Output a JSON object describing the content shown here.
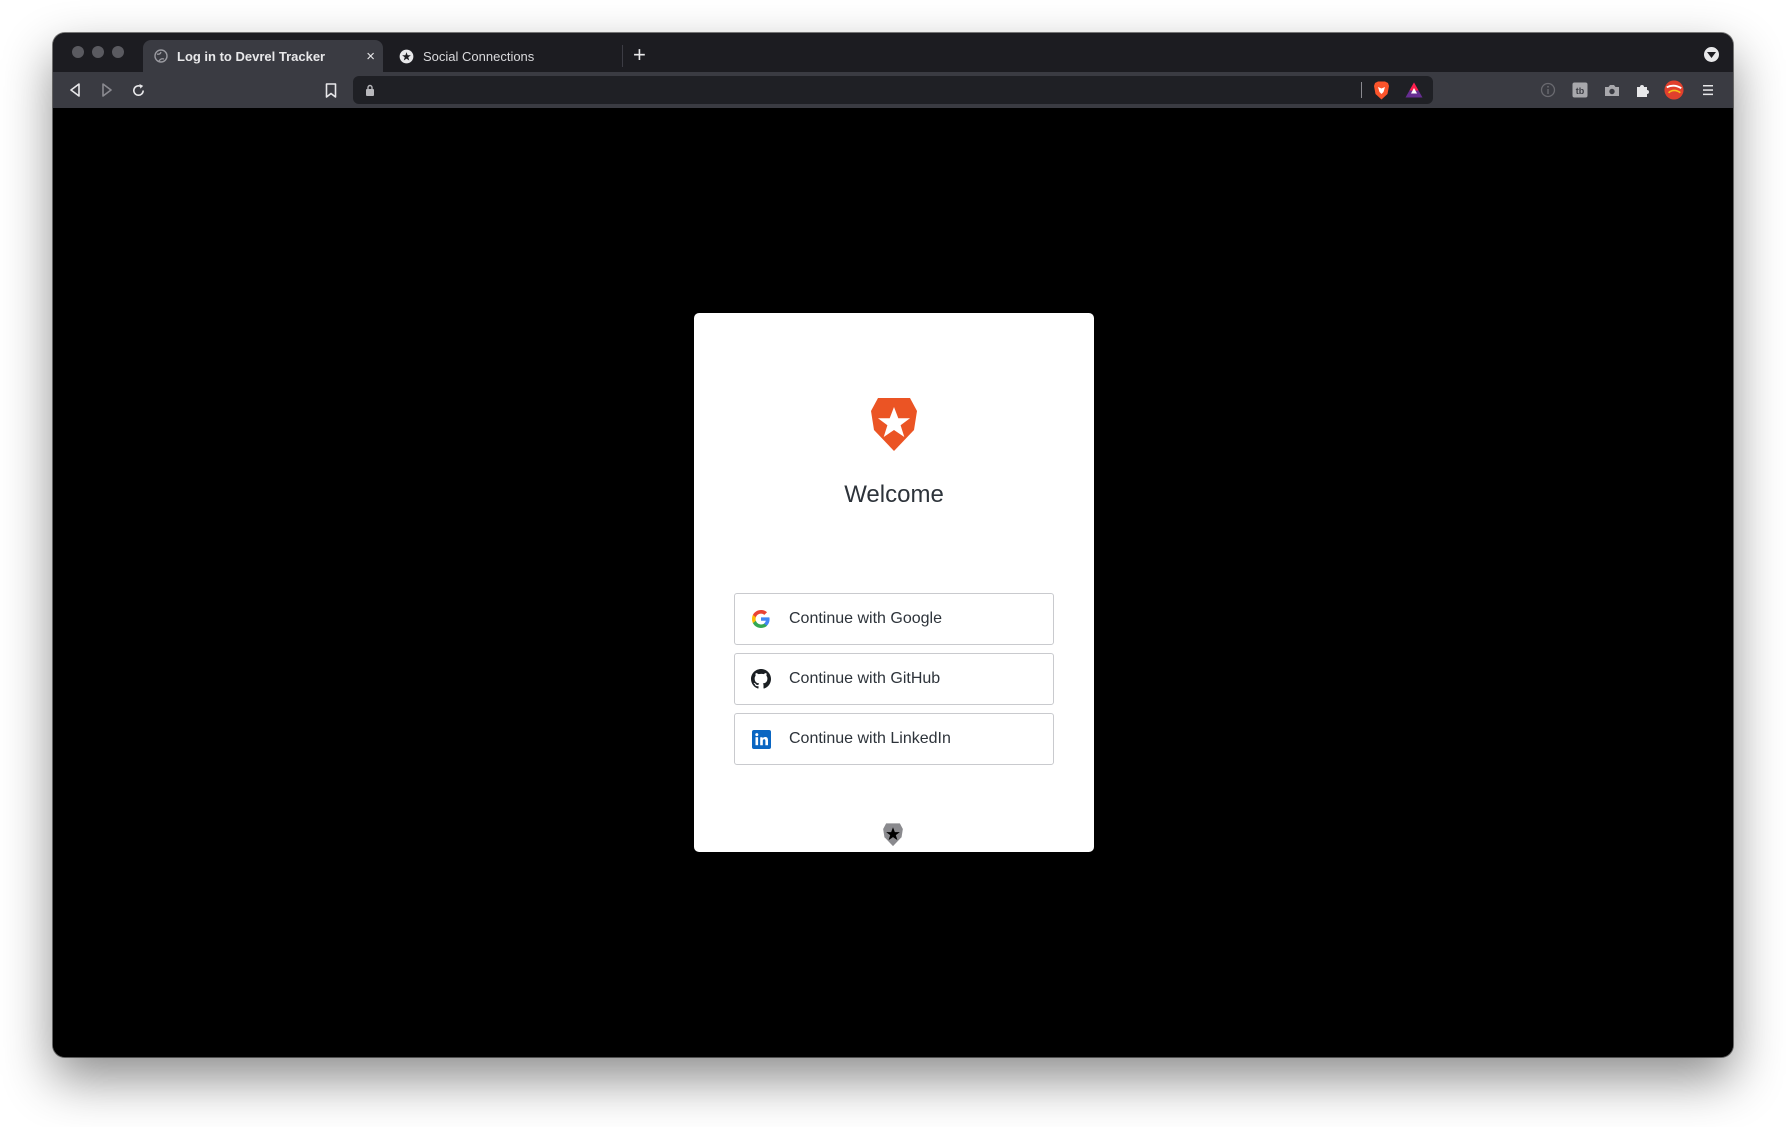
{
  "browser": {
    "tabs": [
      {
        "title": "Log in to Devrel Tracker",
        "active": true
      },
      {
        "title": "Social Connections",
        "active": false
      }
    ],
    "close_tab_symbol": "×",
    "new_tab_symbol": "+",
    "address": ""
  },
  "login": {
    "heading": "Welcome",
    "buttons": [
      {
        "label": "Continue with Google",
        "icon": "google-icon"
      },
      {
        "label": "Continue with GitHub",
        "icon": "github-icon"
      },
      {
        "label": "Continue with LinkedIn",
        "icon": "linkedin-icon"
      }
    ]
  },
  "colors": {
    "brand": "#eb5424",
    "linkedin": "#0a66c2",
    "tab_bar": "#1c1c21",
    "toolbar": "#3a3b42",
    "page_background": "#000000"
  }
}
